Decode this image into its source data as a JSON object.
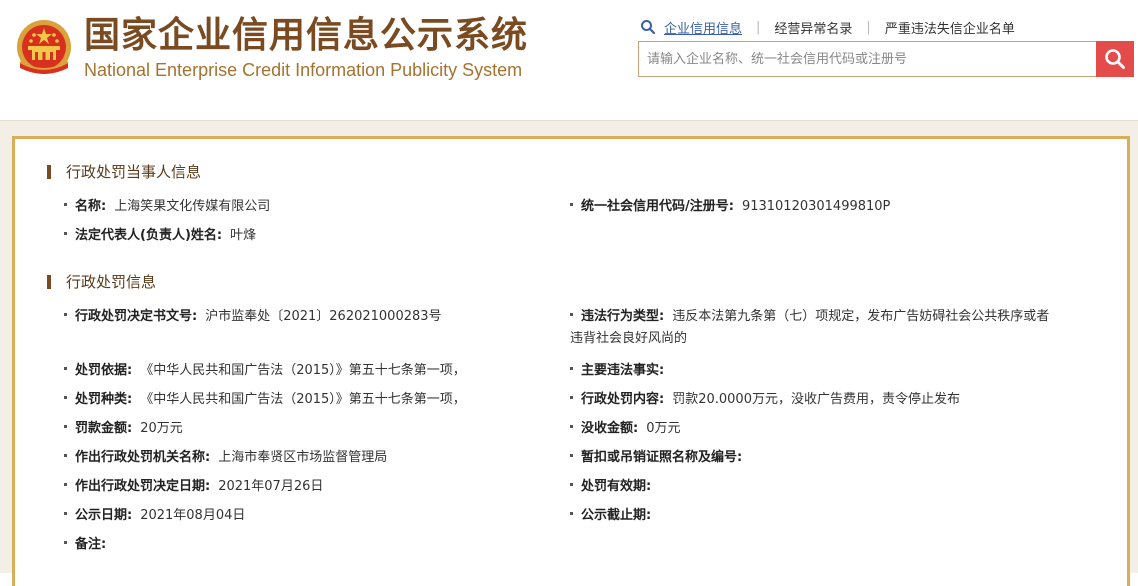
{
  "header": {
    "title_cn": "国家企业信用信息公示系统",
    "title_en": "National Enterprise Credit Information Publicity System",
    "links": [
      "企业信用信息",
      "经营异常名录",
      "严重违法失信企业名单"
    ],
    "search_placeholder": "请输入企业名称、统一社会信用代码或注册号",
    "search_icon": "search-icon",
    "colors": {
      "brand": "#7a4a21",
      "accent": "#e44c4c",
      "link_active": "#3a5fa8"
    }
  },
  "party": {
    "section_title": "行政处罚当事人信息",
    "name_label": "名称:",
    "name_value": "上海笑果文化传媒有限公司",
    "code_label": "统一社会信用代码/注册号:",
    "code_value": "91310120301499810P",
    "rep_label": "法定代表人(负责人)姓名:",
    "rep_value": "叶烽"
  },
  "penalty": {
    "section_title": "行政处罚信息",
    "doc_no_label": "行政处罚决定书文号:",
    "doc_no_value": "沪市监奉处〔2021〕262021000283号",
    "violation_type_label": "违法行为类型:",
    "violation_type_value": "违反本法第九条第（七）项规定，发布广告妨碍社会公共秩序或者违背社会良好风尚的",
    "basis_label": "处罚依据:",
    "basis_value": "《中华人民共和国广告法（2015）》第五十七条第一项，",
    "facts_label": "主要违法事实:",
    "facts_value": "",
    "kind_label": "处罚种类:",
    "kind_value": "《中华人民共和国广告法（2015）》第五十七条第一项，",
    "content_label": "行政处罚内容:",
    "content_value": "罚款20.0000万元，没收广告费用，责令停止发布",
    "fine_label": "罚款金额:",
    "fine_value": "20万元",
    "confiscation_label": "没收金额:",
    "confiscation_value": "0万元",
    "authority_label": "作出行政处罚机关名称:",
    "authority_value": "上海市奉贤区市场监督管理局",
    "license_label": "暂扣或吊销证照名称及编号:",
    "license_value": "",
    "decision_date_label": "作出行政处罚决定日期:",
    "decision_date_value": "2021年07月26日",
    "validity_label": "处罚有效期:",
    "validity_value": "",
    "publish_date_label": "公示日期:",
    "publish_date_value": "2021年08月04日",
    "publish_end_label": "公示截止期:",
    "publish_end_value": "",
    "remark_label": "备注:",
    "remark_value": ""
  }
}
